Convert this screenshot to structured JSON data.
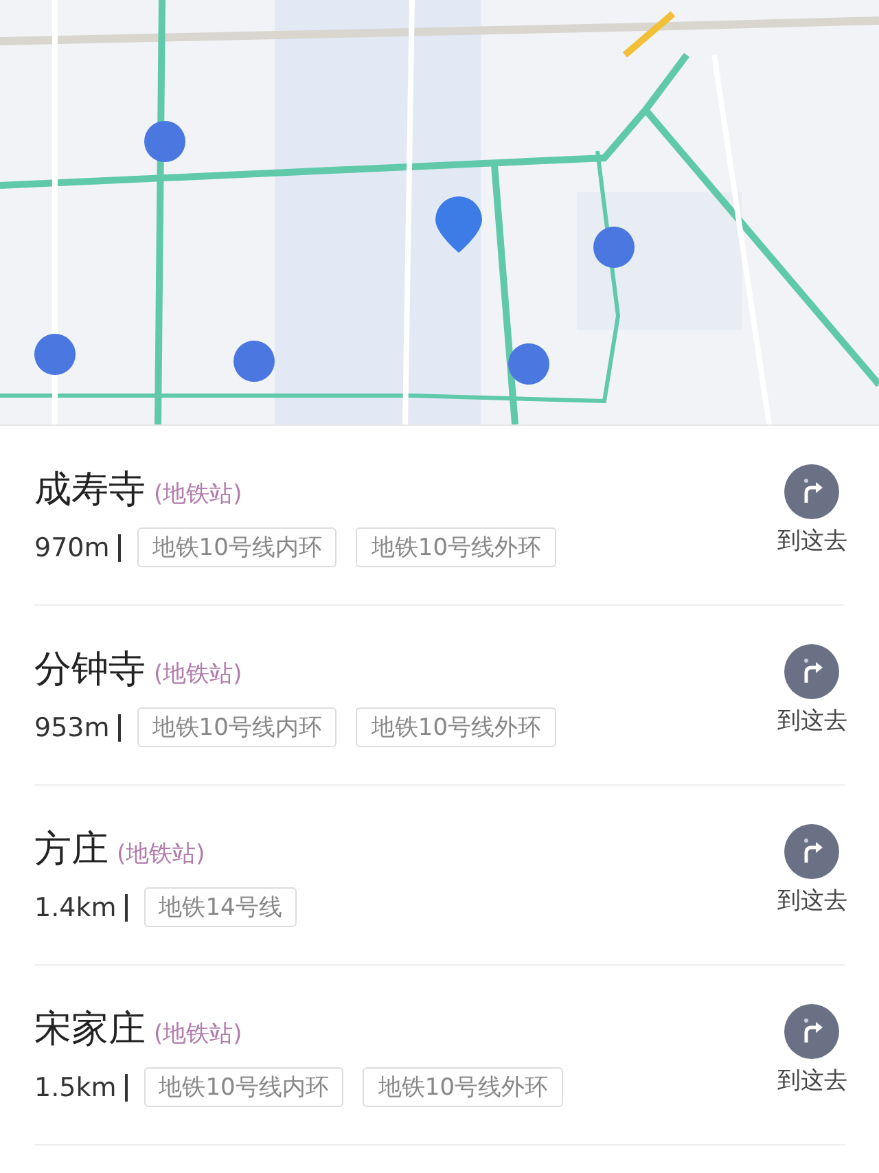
{
  "stations": [
    {
      "name": "成寿寺",
      "category": "(地铁站)",
      "distance": "970m",
      "lines": [
        "地铁10号线内环",
        "地铁10号线外环"
      ],
      "action": "到这去"
    },
    {
      "name": "分钟寺",
      "category": "(地铁站)",
      "distance": "953m",
      "lines": [
        "地铁10号线内环",
        "地铁10号线外环"
      ],
      "action": "到这去"
    },
    {
      "name": "方庄",
      "category": "(地铁站)",
      "distance": "1.4km",
      "lines": [
        "地铁14号线"
      ],
      "action": "到这去"
    },
    {
      "name": "宋家庄",
      "category": "(地铁站)",
      "distance": "1.5km",
      "lines": [
        "地铁10号线内环",
        "地铁10号线外环"
      ],
      "action": "到这去"
    }
  ]
}
